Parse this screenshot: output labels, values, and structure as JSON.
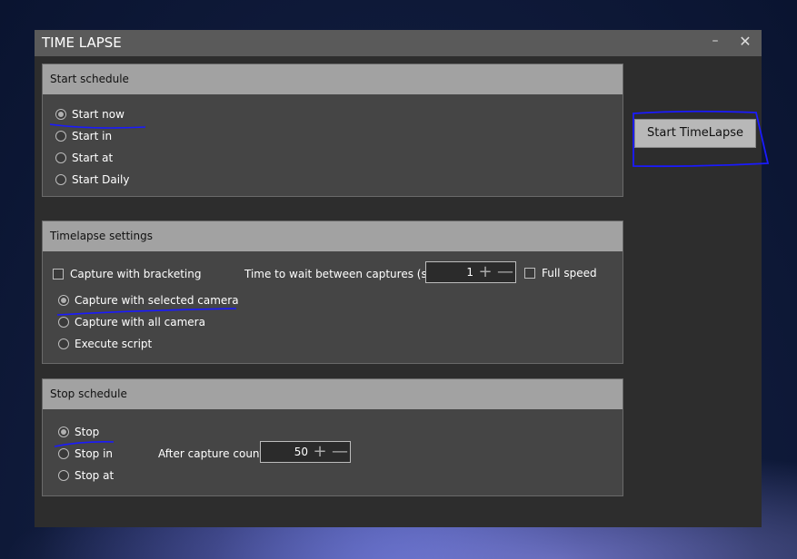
{
  "window": {
    "title": "TIME LAPSE"
  },
  "titlebar": {
    "minimize_glyph": "–",
    "close_glyph": "✕"
  },
  "start_schedule": {
    "header": "Start schedule",
    "options": [
      "Start now",
      "Start in",
      "Start at",
      "Start Daily"
    ],
    "selected": "Start now"
  },
  "timelapse_settings": {
    "header": "Timelapse settings",
    "capture_bracketing": {
      "label": "Capture with bracketing",
      "checked": false
    },
    "wait_label": "Time to wait between captures (sec)",
    "wait_value": "1",
    "full_speed": {
      "label": "Full speed",
      "checked": false
    },
    "capture_options": [
      "Capture with selected camera",
      "Capture with all camera",
      "Execute script"
    ],
    "selected": "Capture with selected camera"
  },
  "stop_schedule": {
    "header": "Stop schedule",
    "options": [
      "Stop",
      "Stop in",
      "Stop at"
    ],
    "selected": "Stop",
    "count_label": "After capture count",
    "count_value": "50"
  },
  "actions": {
    "start_label": "Start TimeLapse"
  },
  "stepper_glyphs": {
    "plus": "+",
    "minus": "—"
  },
  "colors": {
    "titlebar": "#5a5a5a",
    "panel": "#454545",
    "panel_header": "#a2a2a2",
    "annotation": "#1a1aff"
  }
}
